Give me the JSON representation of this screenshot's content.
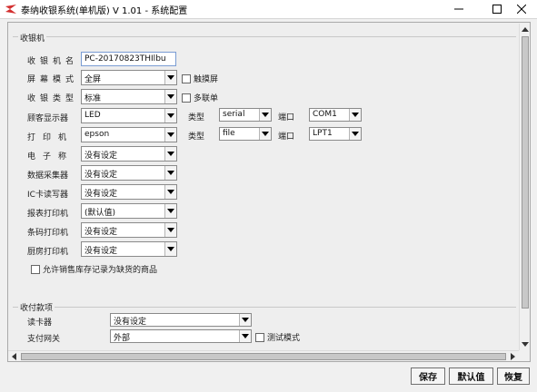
{
  "window": {
    "title": "泰纳收银系统(单机版) V 1.01 - 系统配置",
    "logo_icon": "app-logo-icon",
    "controls": [
      "minimize-icon",
      "maximize-icon",
      "close-icon"
    ]
  },
  "cashier_group": {
    "title": "收银机",
    "fields": {
      "cashier_name": {
        "label": "收银机名",
        "value": "PC-20170823THIlbu"
      },
      "screen_mode": {
        "label": "屏幕模式",
        "value": "全屏",
        "checkbox": "触摸屏"
      },
      "cashier_type": {
        "label": "收银类型",
        "value": "标准",
        "checkbox": "多联单"
      },
      "customer_display": {
        "label": "顾客显示器",
        "value": "LED",
        "type_label": "类型",
        "type_value": "serial",
        "port_label": "端口",
        "port_value": "COM1"
      },
      "printer": {
        "label": "打印机",
        "value": "epson",
        "type_label": "类型",
        "type_value": "file",
        "port_label": "端口",
        "port_value": "LPT1"
      },
      "scale": {
        "label": "电子称",
        "value": "没有设定"
      },
      "data_collector": {
        "label": "数据采集器",
        "value": "没有设定"
      },
      "ic_reader": {
        "label": "IC卡读写器",
        "value": "没有设定"
      },
      "report_printer": {
        "label": "报表打印机",
        "value": "(默认值)"
      },
      "barcode_printer": {
        "label": "条码打印机",
        "value": "没有设定"
      },
      "kitchen_printer": {
        "label": "厨房打印机",
        "value": "没有设定"
      }
    },
    "allow_negative_stock": "允许销售库存记录为缺货的商品"
  },
  "payment_group": {
    "title": "收付款项",
    "card_reader": {
      "label": "读卡器",
      "value": "没有设定"
    },
    "payment_gateway": {
      "label": "支付网关",
      "value": "外部",
      "checkbox": "测试模式"
    }
  },
  "buttons": {
    "save": "保存",
    "default": "默认值",
    "restore": "恢复"
  }
}
